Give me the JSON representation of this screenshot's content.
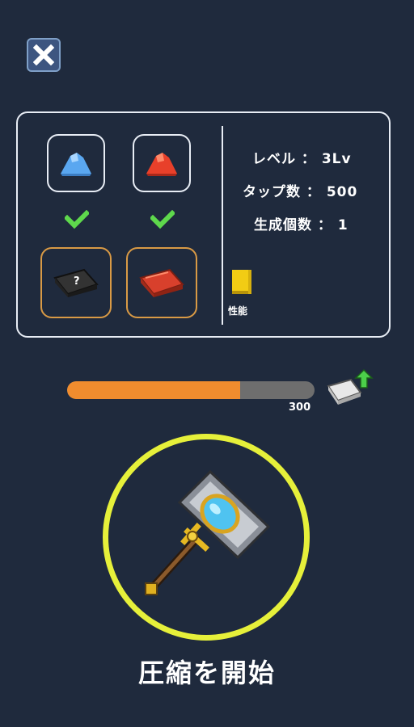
{
  "panel": {
    "stats": {
      "level": "レベル ： 3Lv",
      "taps": "タップ数 ： 500",
      "produced": "生成個数 ： 1"
    },
    "performance_label": "性能",
    "slots": [
      {
        "type": "ore",
        "icon": "blue-ore-pile-icon",
        "color": "#5aa7f0"
      },
      {
        "type": "ore",
        "icon": "red-ore-pile-icon",
        "color": "#e8402a"
      },
      {
        "type": "bar",
        "icon": "unknown-black-ingot-icon",
        "color": "#333333"
      },
      {
        "type": "bar",
        "icon": "red-ingot-icon",
        "color": "#d8402c"
      }
    ]
  },
  "progress": {
    "fraction": 0.7,
    "label": "300"
  },
  "start_button": {
    "label": "圧縮を開始"
  },
  "colors": {
    "background": "#1f2a3d",
    "ring": "#e6f03a",
    "progress_fill": "#f08c2e",
    "check": "#5ed84c"
  }
}
